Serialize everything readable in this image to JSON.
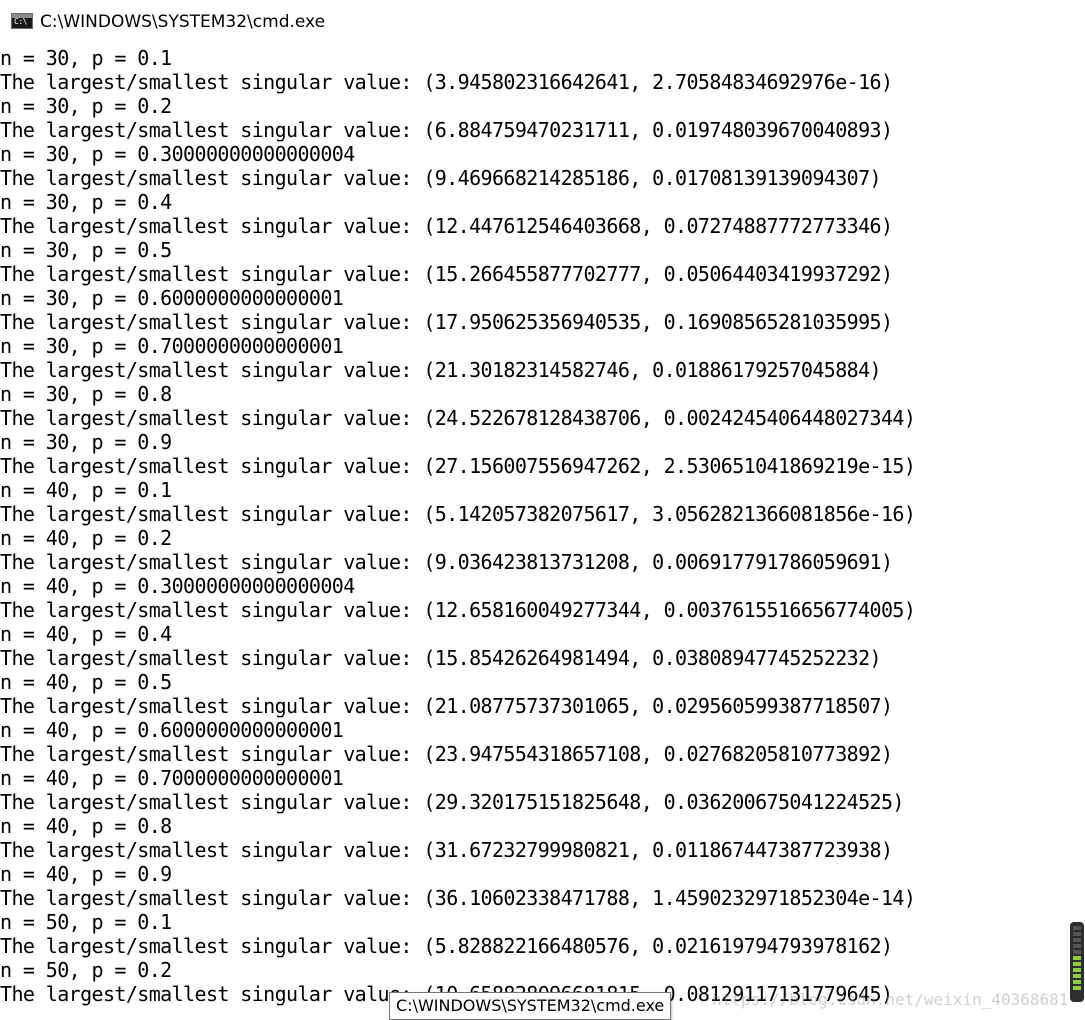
{
  "window": {
    "title": "C:\\WINDOWS\\SYSTEM32\\cmd.exe",
    "icon_label": "C:\\",
    "icon": "cmd-console-icon"
  },
  "console": {
    "lines": [
      "n = 30, p = 0.1",
      "The largest/smallest singular value: (3.945802316642641, 2.70584834692976e-16)",
      "n = 30, p = 0.2",
      "The largest/smallest singular value: (6.884759470231711, 0.019748039670040893)",
      "n = 30, p = 0.30000000000000004",
      "The largest/smallest singular value: (9.469668214285186, 0.01708139139094307)",
      "n = 30, p = 0.4",
      "The largest/smallest singular value: (12.447612546403668, 0.07274887772773346)",
      "n = 30, p = 0.5",
      "The largest/smallest singular value: (15.266455877702777, 0.05064403419937292)",
      "n = 30, p = 0.6000000000000001",
      "The largest/smallest singular value: (17.950625356940535, 0.16908565281035995)",
      "n = 30, p = 0.7000000000000001",
      "The largest/smallest singular value: (21.30182314582746, 0.01886179257045884)",
      "n = 30, p = 0.8",
      "The largest/smallest singular value: (24.522678128438706, 0.0024245406448027344)",
      "n = 30, p = 0.9",
      "The largest/smallest singular value: (27.156007556947262, 2.530651041869219e-15)",
      "n = 40, p = 0.1",
      "The largest/smallest singular value: (5.142057382075617, 3.0562821366081856e-16)",
      "n = 40, p = 0.2",
      "The largest/smallest singular value: (9.036423813731208, 0.006917791786059691)",
      "n = 40, p = 0.30000000000000004",
      "The largest/smallest singular value: (12.658160049277344, 0.0037615516656774005)",
      "n = 40, p = 0.4",
      "The largest/smallest singular value: (15.85426264981494, 0.03808947745252232)",
      "n = 40, p = 0.5",
      "The largest/smallest singular value: (21.08775737301065, 0.029560599387718507)",
      "n = 40, p = 0.6000000000000001",
      "The largest/smallest singular value: (23.947554318657108, 0.02768205810773892)",
      "n = 40, p = 0.7000000000000001",
      "The largest/smallest singular value: (29.320175151825648, 0.036200675041224525)",
      "n = 40, p = 0.8",
      "The largest/smallest singular value: (31.67232799980821, 0.011867447387723938)",
      "n = 40, p = 0.9",
      "The largest/smallest singular value: (36.10602338471788, 1.4590232971852304e-14)",
      "n = 50, p = 0.1",
      "The largest/smallest singular value: (5.828822166480576, 0.021619794793978162)",
      "n = 50, p = 0.2",
      "The largest/smallest singular value: (10.658828096681815, 0.08129117131779645)"
    ]
  },
  "taskbar_tooltip": {
    "text": "C:\\WINDOWS\\SYSTEM32\\cmd.exe"
  },
  "watermark": {
    "text": "https://blog.csdn.net/weixin_40368681"
  },
  "volume_widget": {
    "icon": "volume-level-icon",
    "segments_on": 6,
    "segments_total": 11,
    "on_color": "#8fcf3e"
  }
}
